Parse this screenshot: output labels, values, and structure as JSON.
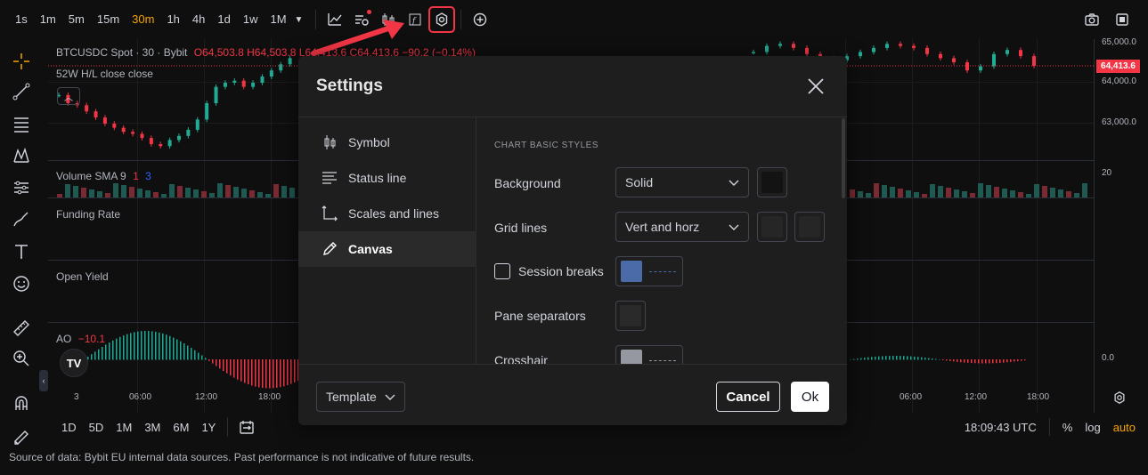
{
  "colors": {
    "accent": "#f7a600",
    "bear": "#f23645",
    "bull": "#22ab94",
    "session_breaks": "#4a6aa8",
    "crosshair": "#9598a1",
    "background_swatch": "#131313"
  },
  "toolbar": {
    "timeframes": [
      "1s",
      "1m",
      "5m",
      "15m",
      "30m",
      "1h",
      "4h",
      "1d",
      "1w",
      "1M"
    ],
    "active_timeframe": "30m",
    "icons": [
      "chart-type-icon",
      "indicators-icon",
      "candles-icon",
      "formula-icon",
      "settings-gear-icon",
      "add-icon"
    ],
    "right_icons": [
      "camera-icon",
      "fullscreen-icon"
    ]
  },
  "legend": {
    "symbol": "BTCUSDC Spot · 30 · Bybit",
    "ohlc": "O64,503.8  H64,503.8  L64,413.6  C64,413.6  −90.2 (−0.14%)",
    "study_52w": "52W H/L close close",
    "volume": "Volume SMA 9",
    "volume_v1": "1",
    "volume_v2": "3",
    "funding": "Funding Rate",
    "open_yield": "Open Yield",
    "ao": "AO",
    "ao_value": "−10.1"
  },
  "price_axis": {
    "labels": [
      "65,000.0",
      "64,000.0",
      "63,000.0",
      "20",
      "0.0"
    ],
    "current_price": "64,413.6"
  },
  "time_axis": {
    "labels": [
      "3",
      "06:00",
      "12:00",
      "18:00",
      "06:00",
      "12:00",
      "18:00"
    ]
  },
  "bottombar": {
    "ranges": [
      "1D",
      "5D",
      "1M",
      "3M",
      "6M",
      "1Y"
    ],
    "clock": "18:09:43 UTC",
    "percent": "%",
    "log": "log",
    "auto": "auto"
  },
  "footer": "Source of data: Bybit EU internal data sources. Past performance is not indicative of future results.",
  "settings": {
    "title": "Settings",
    "nav": [
      {
        "label": "Symbol",
        "icon": "candle-icon"
      },
      {
        "label": "Status line",
        "icon": "status-line-icon"
      },
      {
        "label": "Scales and lines",
        "icon": "scales-icon"
      },
      {
        "label": "Canvas",
        "icon": "pencil-icon"
      }
    ],
    "active_nav": "Canvas",
    "section": "CHART BASIC STYLES",
    "background": {
      "label": "Background",
      "value": "Solid"
    },
    "grid_lines": {
      "label": "Grid lines",
      "value": "Vert and horz"
    },
    "session_breaks": {
      "label": "Session breaks",
      "checked": false
    },
    "pane_separators": {
      "label": "Pane separators"
    },
    "crosshair": {
      "label": "Crosshair"
    },
    "template_label": "Template",
    "cancel_label": "Cancel",
    "ok_label": "Ok"
  },
  "chart_data": {
    "type": "candlestick",
    "series": [
      {
        "name": "BTCUSDC",
        "close": [
          63700,
          63500,
          63450,
          63300,
          63150,
          63000,
          62900,
          62800,
          62750,
          62650,
          62500,
          62450,
          62600,
          62700,
          62850,
          63100,
          63500,
          63900,
          64000,
          64050,
          63900,
          64000,
          64150,
          64300,
          64450,
          64600,
          64750,
          64900,
          64950,
          64850,
          64700,
          64600,
          64550,
          64650,
          64750,
          64850,
          64950,
          64900,
          64850,
          64700,
          64600,
          64500,
          64300,
          64400,
          64700,
          64800,
          64650,
          64413.6
        ]
      }
    ]
  }
}
